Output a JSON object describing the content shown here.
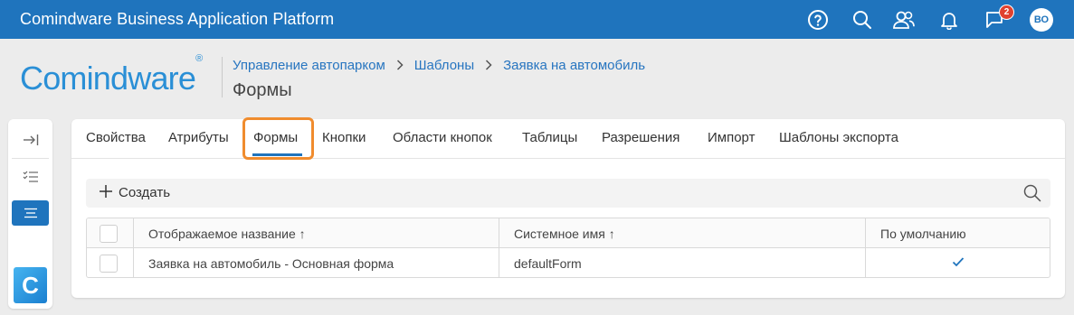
{
  "topbar": {
    "title": "Comindware Business Application Platform",
    "icons": [
      "help-icon",
      "search-icon",
      "users-icon",
      "bell-icon",
      "flag-icon"
    ],
    "notifications_badge": "2",
    "avatar_initials": "ВО"
  },
  "header": {
    "logo_text": "Comindware",
    "logo_mark": "®",
    "breadcrumb": [
      "Управление автопарком",
      "Шаблоны",
      "Заявка на автомобиль"
    ],
    "page_title": "Формы"
  },
  "rail": {
    "icons": [
      "expand-sidebar-icon",
      "checklist-icon",
      "list-icon"
    ],
    "active_index": 2,
    "brand_letter": "C"
  },
  "tabs": {
    "items": [
      "Свойства",
      "Атрибуты",
      "Формы",
      "Кнопки",
      "Области кнопок",
      "Таблицы",
      "Разрешения",
      "Импорт",
      "Шаблоны экспорта"
    ],
    "active": "Формы"
  },
  "toolbar": {
    "create_label": "Создать"
  },
  "table": {
    "columns": [
      "Отображаемое название ↑",
      "Системное имя ↑",
      "По умолчанию"
    ],
    "rows": [
      {
        "display_name": "Заявка на автомобиль - Основная форма",
        "system_name": "defaultForm",
        "is_default": true
      }
    ]
  },
  "colors": {
    "primary": "#1f74bd",
    "highlight": "#f08c2e",
    "badge": "#e0412f"
  }
}
